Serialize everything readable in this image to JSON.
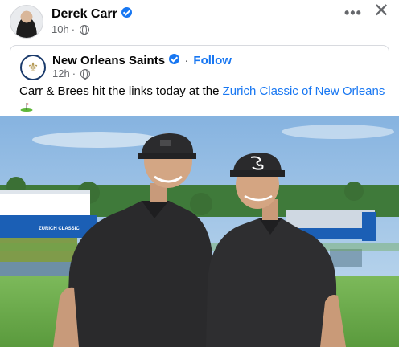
{
  "post": {
    "author_name": "Derek Carr",
    "timestamp": "10h",
    "separator": "·"
  },
  "shared": {
    "page_name": "New Orleans Saints",
    "follow_label": "Follow",
    "separator": "·",
    "timestamp": "12h",
    "caption_prefix": "Carr & Brees hit the links today at the ",
    "caption_link": "Zurich Classic of New Orleans"
  },
  "icons": {
    "more": "more-options-icon",
    "close": "close-icon",
    "globe": "globe-icon",
    "verified": "verified-badge-icon",
    "golf": "golf-flag-icon"
  },
  "photo": {
    "banner_text": "ZURICH CLASSIC",
    "colors": {
      "sky": "#9dc3e6",
      "grass": "#6fae4a",
      "shirt": "#2a2a2c",
      "banner": "#1b5fb5"
    }
  }
}
